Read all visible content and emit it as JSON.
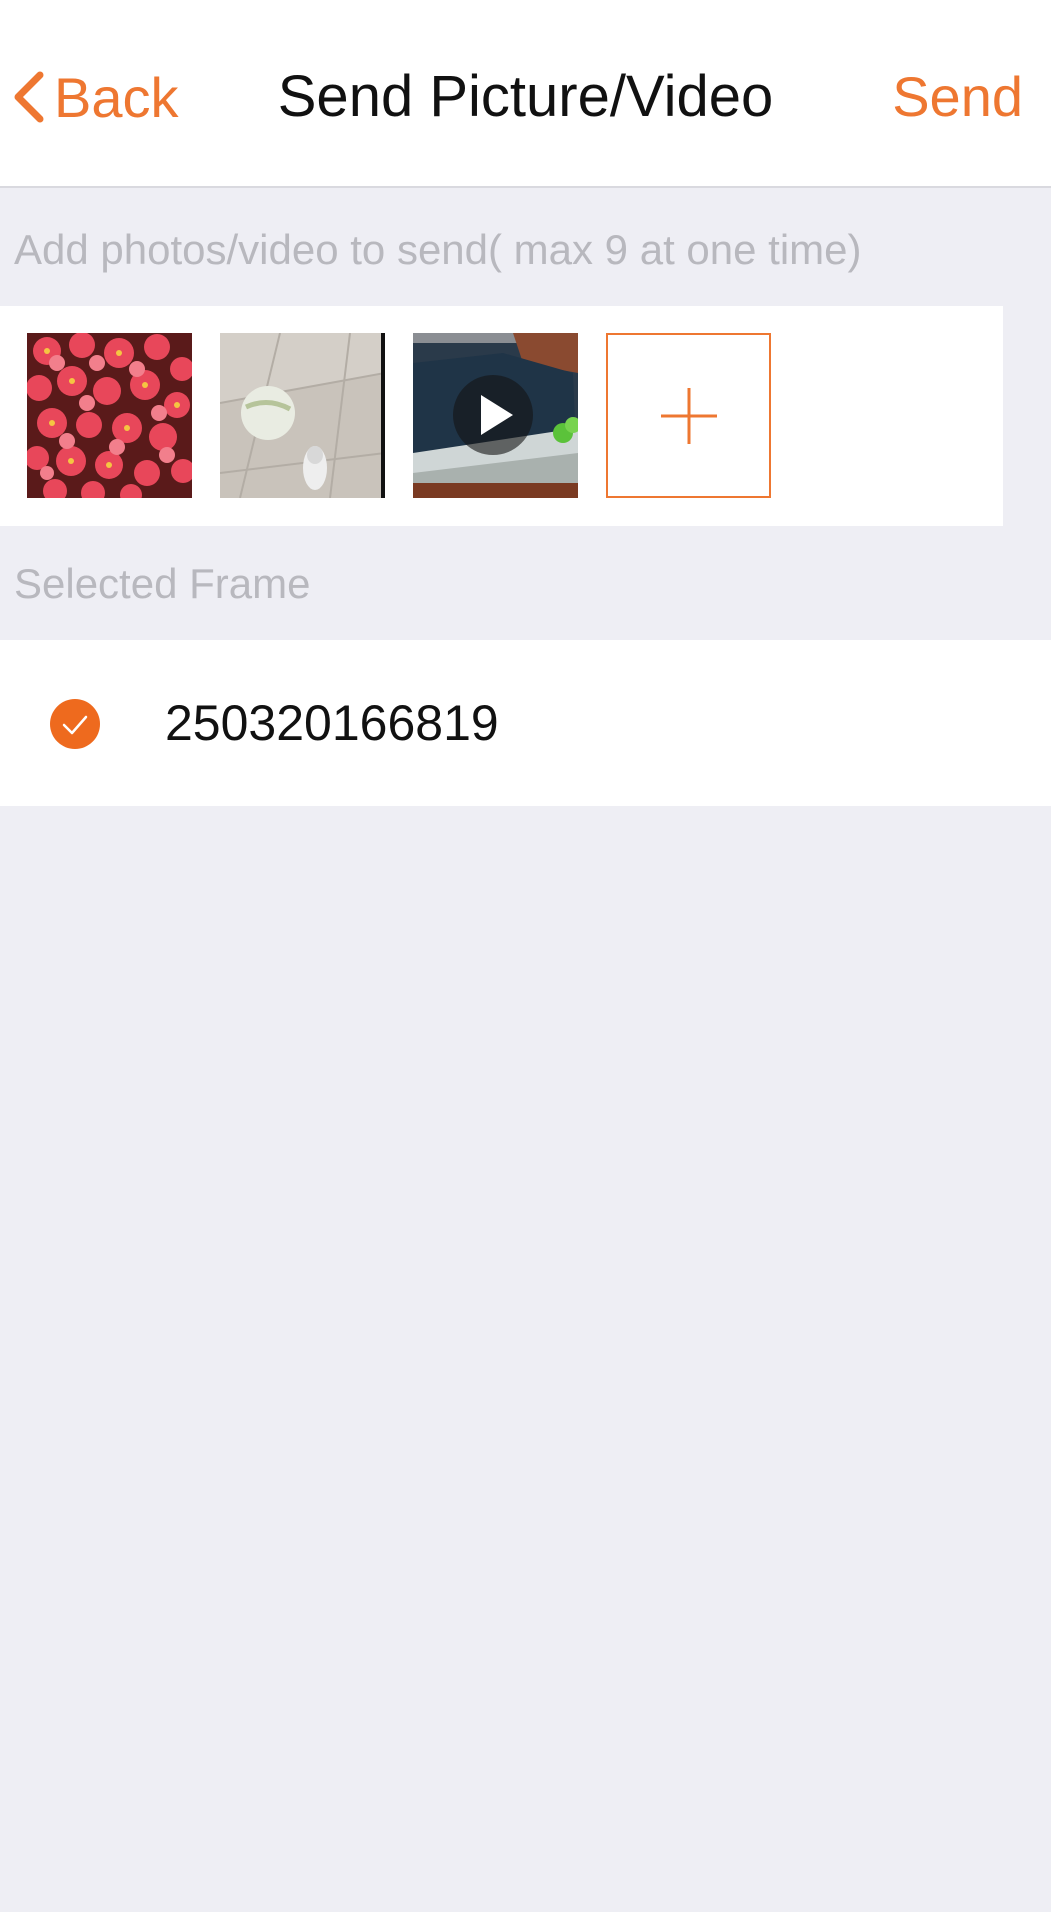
{
  "header": {
    "back_label": "Back",
    "title": "Send Picture/Video",
    "send_label": "Send"
  },
  "media": {
    "hint": "Add photos/video to send( max 9 at one time)",
    "items": [
      {
        "type": "photo",
        "subject": "pink flowers"
      },
      {
        "type": "photo",
        "subject": "ball on tiled floor"
      },
      {
        "type": "video",
        "subject": "fish tank",
        "icon": "play-icon"
      }
    ],
    "add_icon": "plus-icon"
  },
  "frames": {
    "section_label": "Selected Frame",
    "items": [
      {
        "id": "250320166819",
        "selected": true
      }
    ]
  },
  "colors": {
    "accent": "#ee7731",
    "background": "#eeeef4",
    "secondary_text": "#b8b8be"
  }
}
